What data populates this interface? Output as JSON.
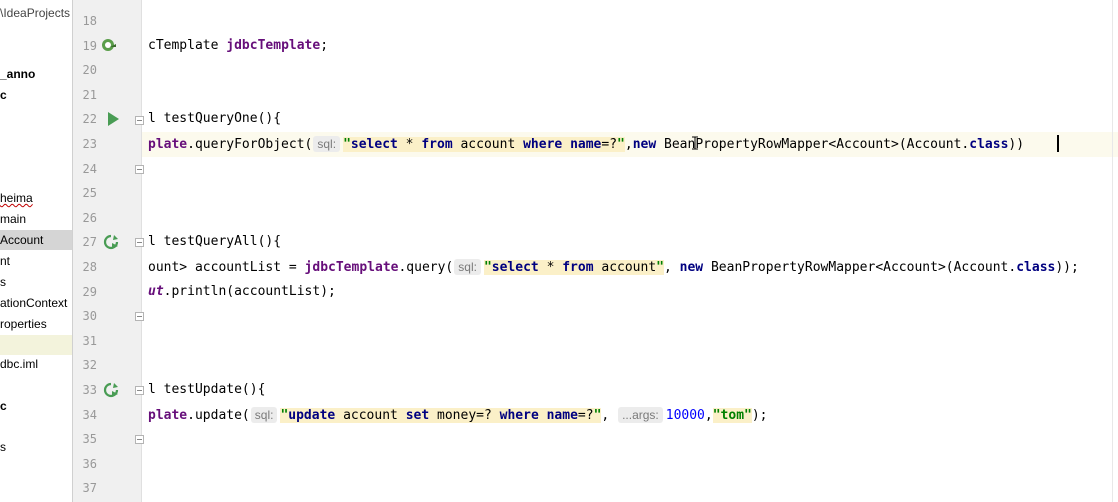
{
  "tree": {
    "items": [
      {
        "label": "\\IdeaProjects",
        "style": "path"
      },
      {
        "label": "_anno",
        "style": "bold"
      },
      {
        "label": "c",
        "style": "bold"
      },
      {
        "label": "heima",
        "style": "wavy"
      },
      {
        "label": "main",
        "style": "normal"
      },
      {
        "label": "Account",
        "style": "sel"
      },
      {
        "label": "nt",
        "style": "normal"
      },
      {
        "label": "s",
        "style": "normal"
      },
      {
        "label": "ationContext",
        "style": "normal"
      },
      {
        "label": "roperties",
        "style": "normal"
      },
      {
        "label": "",
        "style": "band"
      },
      {
        "label": "dbc.iml",
        "style": "normal"
      },
      {
        "label": "c",
        "style": "bold"
      },
      {
        "label": "s",
        "style": "normal"
      }
    ]
  },
  "gutter": {
    "lines": [
      "18",
      "19",
      "20",
      "21",
      "22",
      "23",
      "24",
      "25",
      "26",
      "27",
      "28",
      "29",
      "30",
      "31",
      "32",
      "33",
      "34",
      "35",
      "36",
      "37"
    ]
  },
  "editor": {
    "line19": {
      "a": "cTemplate ",
      "b": "jdbcTemplate",
      "c": ";"
    },
    "line22": {
      "a": "l testQueryOne(){"
    },
    "line23": {
      "a": "plate",
      "b": ".queryForObject(",
      "hint": "sql:",
      "q": "\"",
      "s1": "select",
      "s2": " * ",
      "s3": "from",
      "s4": " account ",
      "s5": "where",
      "s6": " ",
      "s7": "name",
      "s8": "=?",
      "q2": "\"",
      "c": ",",
      "kw": "new",
      "d": " BeanPropertyRowMapper<Account>(Account.",
      "e": "class",
      "f": "))"
    },
    "line27": {
      "a": "l testQueryAll(){"
    },
    "line28": {
      "a": "ount> accountList = ",
      "b": "jdbcTemplate",
      "c": ".query(",
      "hint": "sql:",
      "q": "\"",
      "s1": "select",
      "s2": " * ",
      "s3": "from",
      "s4": " account",
      "q2": "\"",
      "d": ", ",
      "kw": "new",
      "e": " BeanPropertyRowMapper<Account>(Account.",
      "f": "class",
      "g": "));"
    },
    "line29": {
      "a": "ut",
      "b": ".println(accountList);"
    },
    "line33": {
      "a": "l testUpdate(){"
    },
    "line34": {
      "a": "plate",
      "b": ".update(",
      "hint": "sql:",
      "q": "\"",
      "s1": "update",
      "s2": " account ",
      "s3": "set",
      "s4": " money=? ",
      "s5": "where",
      "s6": " ",
      "s7": "name",
      "s8": "=?",
      "q2": "\"",
      "c": ", ",
      "hint2": "...args:",
      "num": "10000",
      "d": ",",
      "str": "\"tom\"",
      "e": ");"
    }
  },
  "colors": {
    "keyword": "#000080",
    "field": "#660e7a",
    "string": "#008000",
    "number": "#0000ff",
    "caret_row": "#fcfaed"
  }
}
